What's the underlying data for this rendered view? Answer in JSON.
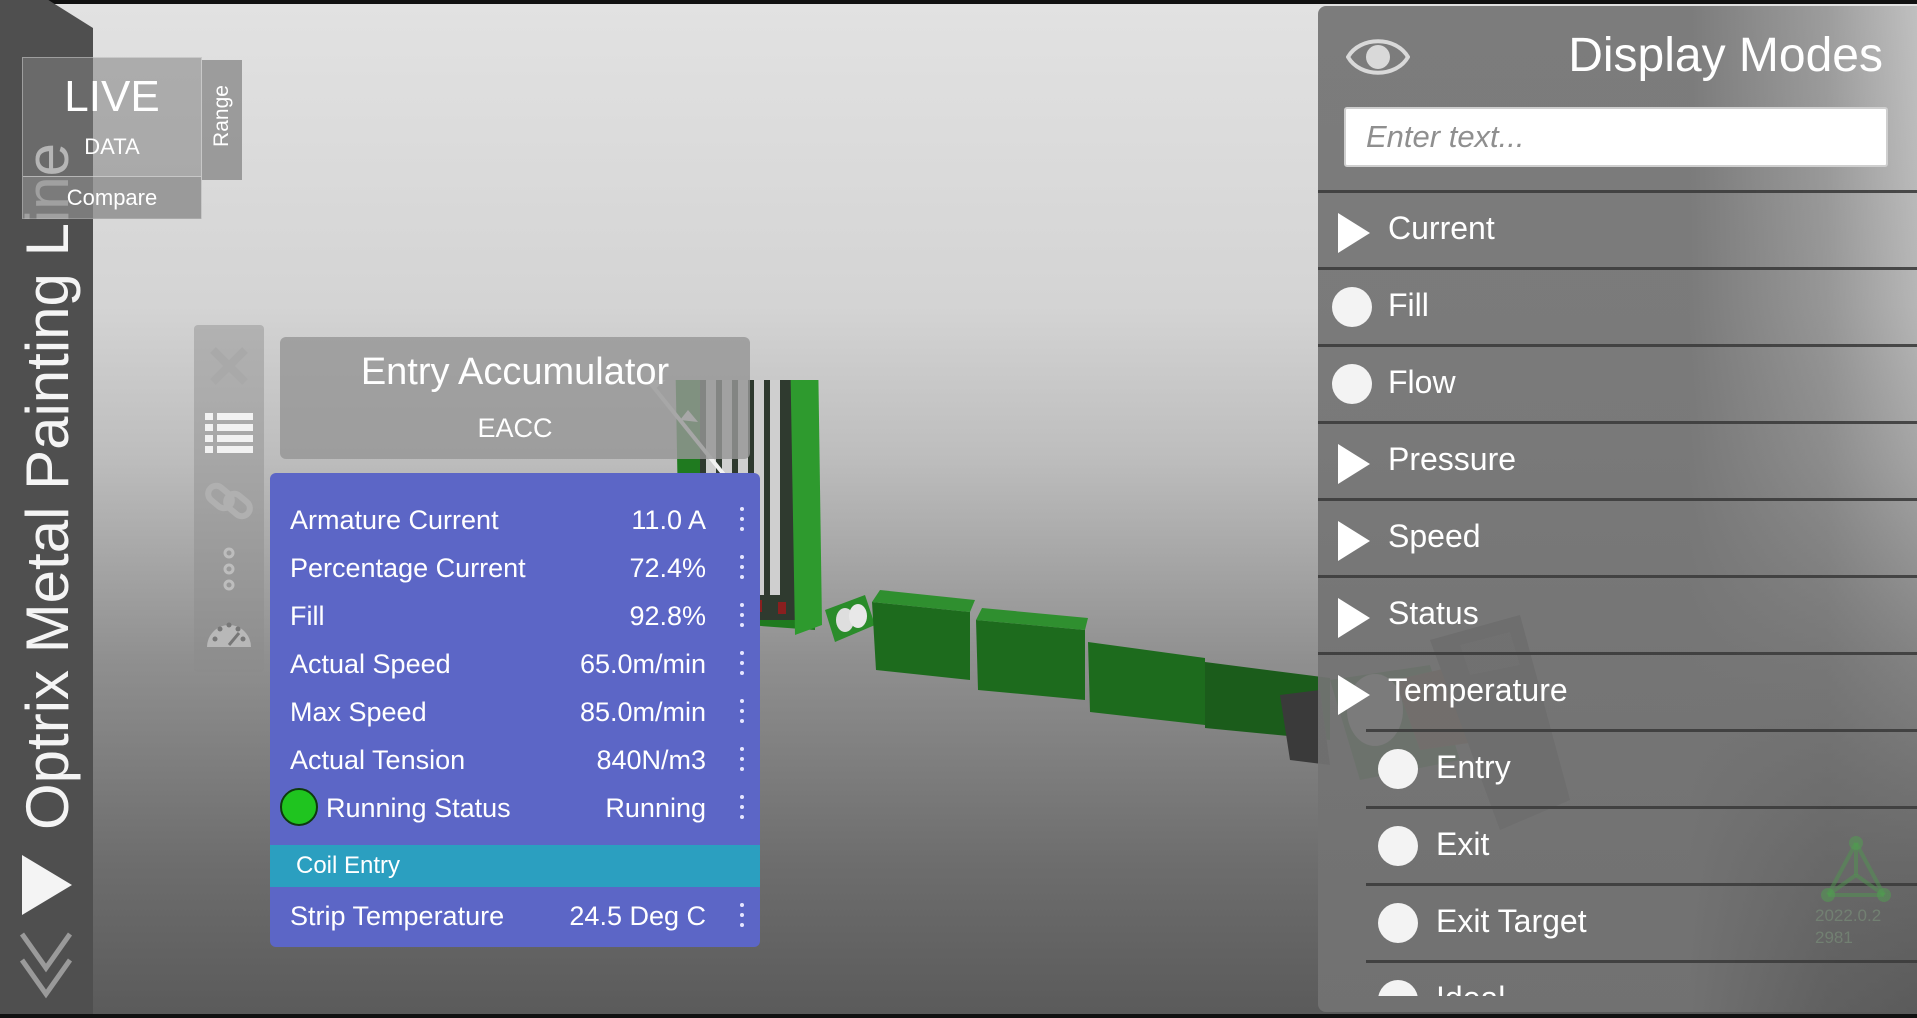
{
  "app": {
    "title": "Optrix Metal Painting Line",
    "version": "2022.0.2",
    "build": "2981"
  },
  "live_panel": {
    "title": "LIVE",
    "subtitle": "DATA",
    "compare_label": "Compare",
    "range_label": "Range"
  },
  "tools": {
    "icons": [
      "close-icon",
      "list-icon",
      "link-icon",
      "more-vertical-icon",
      "gauge-icon"
    ]
  },
  "asset": {
    "name": "Entry Accumulator",
    "code": "EACC"
  },
  "data_card": {
    "rows": [
      {
        "label": "Armature Current",
        "value": "11.0 A"
      },
      {
        "label": "Percentage Current",
        "value": "72.4%"
      },
      {
        "label": "Fill",
        "value": "92.8%"
      },
      {
        "label": "Actual Speed",
        "value": "65.0m/min"
      },
      {
        "label": "Max Speed",
        "value": "85.0m/min"
      },
      {
        "label": "Actual Tension",
        "value": "840N/m3"
      },
      {
        "label": "Running Status",
        "value": "Running"
      }
    ],
    "section": "Coil Entry",
    "section_rows": [
      {
        "label": "Strip Temperature",
        "value": "24.5 Deg C"
      }
    ],
    "status_color": "#1fc41f",
    "card_color": "#5c66c6",
    "section_color": "#2b9fc0"
  },
  "display_modes": {
    "title": "Display Modes",
    "search_placeholder": "Enter text...",
    "items": [
      {
        "label": "Current",
        "kind": "expand"
      },
      {
        "label": "Fill",
        "kind": "radio"
      },
      {
        "label": "Flow",
        "kind": "radio"
      },
      {
        "label": "Pressure",
        "kind": "expand"
      },
      {
        "label": "Speed",
        "kind": "expand"
      },
      {
        "label": "Status",
        "kind": "expand"
      },
      {
        "label": "Temperature",
        "kind": "expand"
      }
    ],
    "sub_items": [
      {
        "label": "Entry",
        "kind": "radio"
      },
      {
        "label": "Exit",
        "kind": "radio"
      },
      {
        "label": "Exit Target",
        "kind": "radio"
      },
      {
        "label": "Ideal",
        "kind": "radio"
      }
    ]
  }
}
